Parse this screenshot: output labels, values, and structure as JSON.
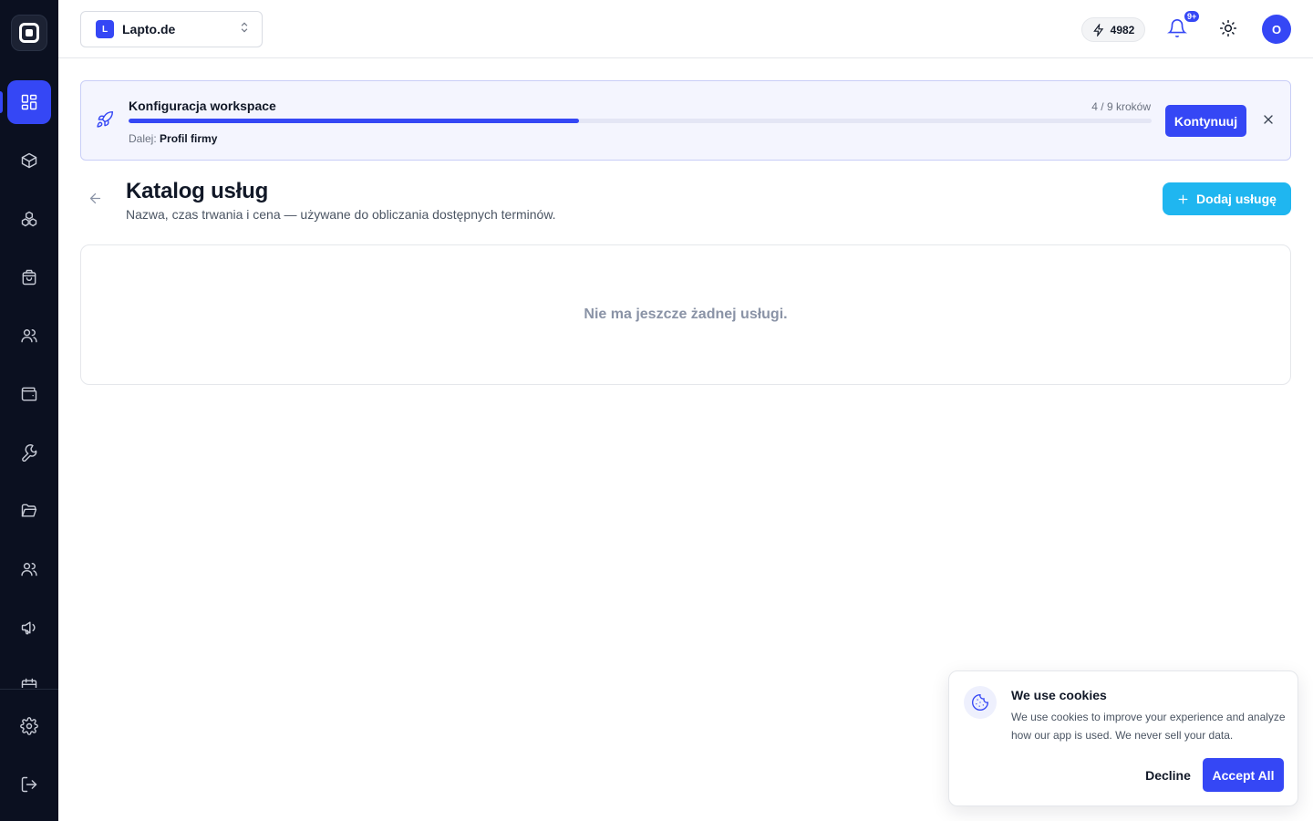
{
  "sidebar": {
    "items": [
      {
        "icon": "dashboard-icon",
        "active": true
      },
      {
        "icon": "package-icon",
        "active": false
      },
      {
        "icon": "boxes-icon",
        "active": false
      },
      {
        "icon": "shopping-bag-icon",
        "active": false
      },
      {
        "icon": "users-icon",
        "active": false
      },
      {
        "icon": "wallet-icon",
        "active": false
      },
      {
        "icon": "wrench-icon",
        "active": false
      },
      {
        "icon": "folder-open-icon",
        "active": false
      },
      {
        "icon": "team-icon",
        "active": false
      },
      {
        "icon": "megaphone-icon",
        "active": false
      },
      {
        "icon": "calendar-icon",
        "active": false
      }
    ],
    "bottom": [
      {
        "icon": "settings-icon"
      },
      {
        "icon": "logout-icon"
      }
    ]
  },
  "topbar": {
    "workspace_initial": "L",
    "workspace_name": "Lapto.de",
    "credits": "4982",
    "notification_badge": "9+",
    "avatar_initial": "O"
  },
  "setup": {
    "title": "Konfiguracja workspace",
    "steps": "4 / 9 kroków",
    "progress_percent": 44,
    "next_label": "Dalej:",
    "next_value": "Profil firmy",
    "continue_label": "Kontynuuj"
  },
  "page": {
    "title": "Katalog usług",
    "subtitle": "Nazwa, czas trwania i cena — używane do obliczania dostępnych terminów.",
    "add_label": "Dodaj usługę",
    "empty_text": "Nie ma jeszcze żadnej usługi."
  },
  "cookies": {
    "title": "We use cookies",
    "text": "We use cookies to improve your experience and analyze how our app is used. We never sell your data.",
    "decline_label": "Decline",
    "accept_label": "Accept All"
  },
  "colors": {
    "sidebar_bg": "#0b1020",
    "primary": "#3547f5",
    "accent": "#1fb6f0"
  }
}
